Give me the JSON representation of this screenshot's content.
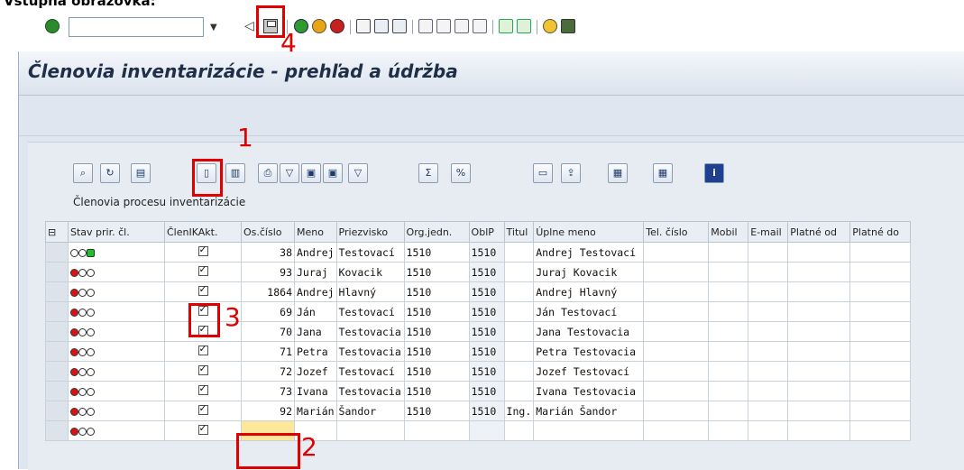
{
  "caption": "Vstupná obrazovka:",
  "colors": {
    "red_marker": "#e00000",
    "green_light": "#19c32a",
    "red_light": "#e01010",
    "input_highlight": "#fde79a"
  },
  "toolbar": {
    "command_field_value": "",
    "icons": [
      "enter-check-icon",
      "back-icon",
      "save-icon",
      "green-arrow-icon",
      "up-icon",
      "cancel-icon",
      "print-icon",
      "find-icon",
      "find-next-icon",
      "first-page-icon",
      "prev-page-icon",
      "next-page-icon",
      "last-page-icon",
      "new-session-icon",
      "shortcut-icon",
      "help-icon",
      "layout-icon"
    ]
  },
  "window": {
    "title": "Členovia inventarizácie - prehľad a údržba"
  },
  "grid": {
    "caption": "Členovia procesu inventarizácie",
    "alv_icons": [
      "details-icon",
      "refresh-icon",
      "clipboard-icon",
      "new-entry-icon",
      "copy-row-icon",
      "print-icon",
      "filter-icon",
      "find-icon",
      "find-next-icon",
      "set-filter-icon",
      "sum-icon",
      "subtotal-icon",
      "print-preview-icon",
      "export-icon",
      "views-icon",
      "layout-icon",
      "info-icon"
    ],
    "columns": [
      "Stav prir. čl.",
      "ČlenIKAkt.",
      "Os.číslo",
      "Meno",
      "Priezvisko",
      "Org.jedn.",
      "OblP",
      "Titul",
      "Úplne meno",
      "Tel. číslo",
      "Mobil",
      "E-mail",
      "Platné od",
      "Platné do"
    ],
    "rows": [
      {
        "status": "green",
        "active": true,
        "os": "38",
        "meno": "Andrej",
        "priezvisko": "Testovací",
        "org": "1510",
        "oblp": "1510",
        "titul": "",
        "uplne": "Andrej Testovací"
      },
      {
        "status": "red",
        "active": true,
        "os": "93",
        "meno": "Juraj",
        "priezvisko": "Kovacik",
        "org": "1510",
        "oblp": "1510",
        "titul": "",
        "uplne": "Juraj Kovacik"
      },
      {
        "status": "red",
        "active": true,
        "os": "1864",
        "meno": "Andrej",
        "priezvisko": "Hlavný",
        "org": "1510",
        "oblp": "1510",
        "titul": "",
        "uplne": "Andrej Hlavný"
      },
      {
        "status": "red",
        "active": true,
        "os": "69",
        "meno": "Ján",
        "priezvisko": "Testovací",
        "org": "1510",
        "oblp": "1510",
        "titul": "",
        "uplne": "Ján Testovací"
      },
      {
        "status": "red",
        "active": true,
        "os": "70",
        "meno": "Jana",
        "priezvisko": "Testovacia",
        "org": "1510",
        "oblp": "1510",
        "titul": "",
        "uplne": "Jana Testovacia"
      },
      {
        "status": "red",
        "active": true,
        "os": "71",
        "meno": "Petra",
        "priezvisko": "Testovacia",
        "org": "1510",
        "oblp": "1510",
        "titul": "",
        "uplne": "Petra Testovacia"
      },
      {
        "status": "red",
        "active": true,
        "os": "72",
        "meno": "Jozef",
        "priezvisko": "Testovací",
        "org": "1510",
        "oblp": "1510",
        "titul": "",
        "uplne": "Jozef Testovací"
      },
      {
        "status": "red",
        "active": true,
        "os": "73",
        "meno": "Ivana",
        "priezvisko": "Testovacia",
        "org": "1510",
        "oblp": "1510",
        "titul": "",
        "uplne": "Ivana Testovacia"
      },
      {
        "status": "red",
        "active": true,
        "os": "92",
        "meno": "Marián",
        "priezvisko": "Šandor",
        "org": "1510",
        "oblp": "1510",
        "titul": "Ing.",
        "uplne": "Marián Šandor"
      },
      {
        "status": "red",
        "active": true,
        "os": "",
        "meno": "",
        "priezvisko": "",
        "org": "",
        "oblp": "",
        "titul": "",
        "uplne": ""
      }
    ]
  },
  "annotations": {
    "m1": "1",
    "m2": "2",
    "m3": "3",
    "m4": "4"
  }
}
